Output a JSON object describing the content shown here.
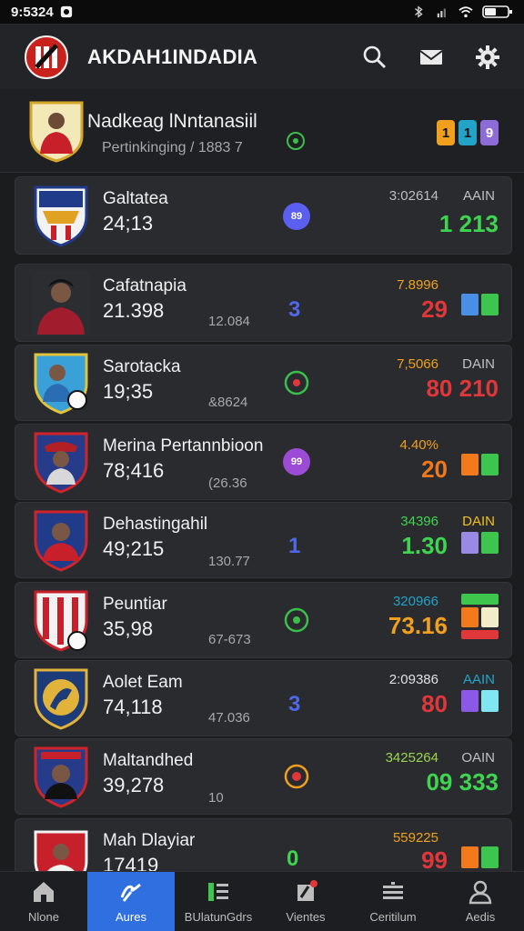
{
  "status": {
    "time": "9:5324"
  },
  "app": {
    "title": "AKDAH1INDADIA"
  },
  "header": {
    "name": "Nadkeag lNntanasiil",
    "sub": "Pertinkinging / 1883 7",
    "chips": [
      "1",
      "1",
      "9"
    ]
  },
  "cards": [
    {
      "name": "Galtatea",
      "score": "24;13",
      "sub": "",
      "badge": "89",
      "mid": "",
      "stat_top": "3:02614",
      "tag": "AAIN",
      "stat_big": "1 213"
    },
    {
      "name": "Cafatnapia",
      "score": "21.398",
      "sub": "12.084",
      "badge": "",
      "mid": "3",
      "stat_top": "7.8996",
      "tag": "",
      "stat_big": "29"
    },
    {
      "name": "Sarotacka",
      "score": "19;35",
      "sub": "&8624",
      "badge": "",
      "mid": "",
      "stat_top": "7,5066",
      "tag": "DAIN",
      "stat_big": "80 210"
    },
    {
      "name": "Merina Pertannbioon",
      "score": "78;416",
      "sub": "(26.36",
      "badge": "99",
      "mid": "",
      "stat_top": "4.40%",
      "tag": "",
      "stat_big": "20"
    },
    {
      "name": "Dehastingahil",
      "score": "49;215",
      "sub": "130.77",
      "badge": "",
      "mid": "1",
      "stat_top": "34396",
      "tag": "DAIN",
      "stat_big": "1.30"
    },
    {
      "name": "Peuntiar",
      "score": "35,98",
      "sub": "67-673",
      "badge": "",
      "mid": "",
      "stat_top": "320966",
      "tag": "",
      "stat_big": "73.16"
    },
    {
      "name": "Aolet Eam",
      "score": "74,118",
      "sub": "47.036",
      "badge": "",
      "mid": "3",
      "stat_top": "2:09386",
      "tag": "AAIN",
      "stat_big": "80"
    },
    {
      "name": "Maltandhed",
      "score": "39,278",
      "sub": "10",
      "badge": "",
      "mid": "",
      "stat_top": "3425264",
      "tag": "OAIN",
      "stat_big": "09 333"
    },
    {
      "name": "Mah Dlayiar",
      "score": "17419",
      "sub": "",
      "badge": "",
      "mid": "0",
      "stat_top": "559225",
      "tag": "",
      "stat_big": "99"
    }
  ],
  "nav": [
    "Nlone",
    "Aures",
    "BUlatunGdrs",
    "Vientes",
    "Ceritilum",
    "Aedis"
  ]
}
